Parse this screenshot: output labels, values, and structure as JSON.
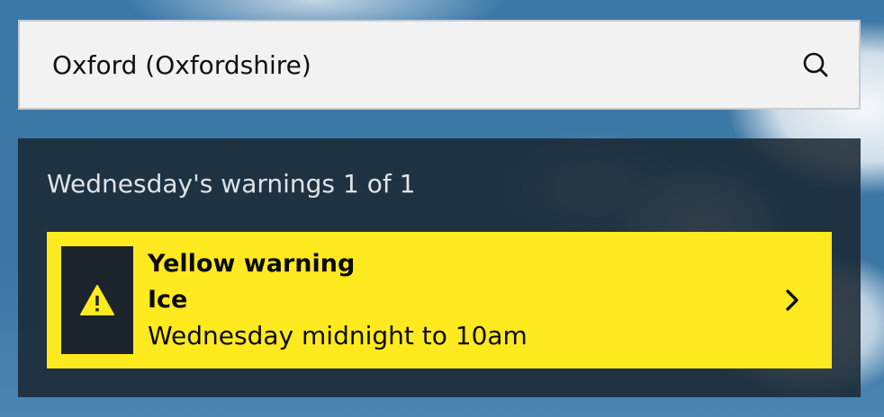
{
  "search": {
    "value": "Oxford (Oxfordshire)",
    "icon": "search-icon"
  },
  "warnings": {
    "heading_day": "Wednesday's warnings",
    "heading_count": "1 of 1",
    "items": [
      {
        "level": "Yellow warning",
        "type": "Ice",
        "time": "Wednesday midnight to 10am",
        "icon": "warning-triangle-icon",
        "color": "#ffea1f"
      }
    ]
  },
  "colors": {
    "panel": "#1a2632",
    "card": "#ffea1f",
    "icon_box": "#1b232b"
  }
}
